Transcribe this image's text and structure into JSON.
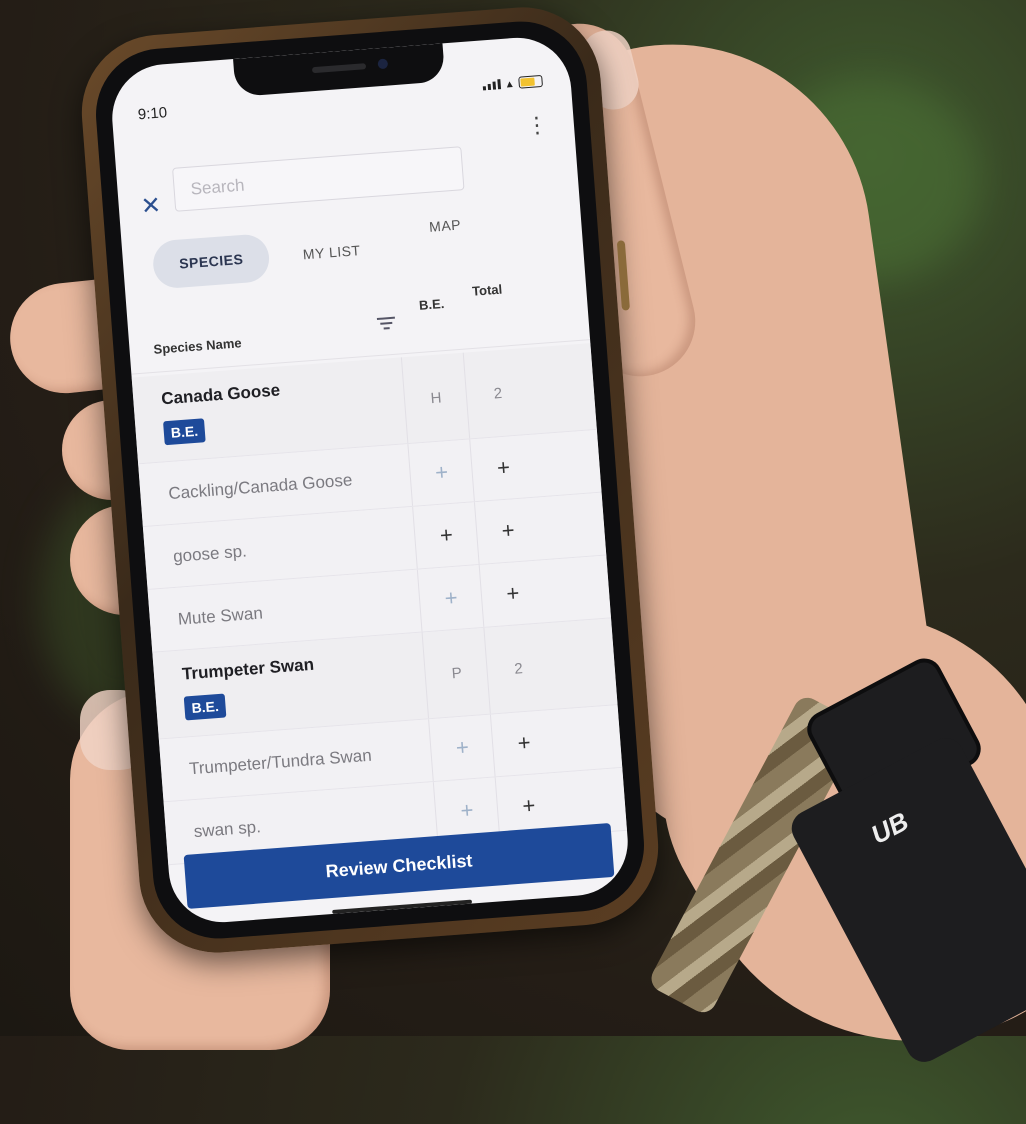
{
  "status_bar": {
    "time": "9:10"
  },
  "search": {
    "placeholder": "Search"
  },
  "tabs": [
    {
      "label": "SPECIES",
      "active": true
    },
    {
      "label": "MY LIST",
      "active": false
    },
    {
      "label": "MAP",
      "active": false
    }
  ],
  "columns": {
    "species": "Species Name",
    "be": "B.E.",
    "total": "Total"
  },
  "species": [
    {
      "name": "Canada Goose",
      "bold": true,
      "badge": "B.E.",
      "be": "H",
      "total": "2"
    },
    {
      "name": "Cackling/Canada Goose",
      "bold": false,
      "be": "+",
      "total": "+"
    },
    {
      "name": "goose sp.",
      "bold": false,
      "be": "+",
      "total": "+"
    },
    {
      "name": "Mute Swan",
      "bold": false,
      "be": "+",
      "total": "+"
    },
    {
      "name": "Trumpeter Swan",
      "bold": true,
      "badge": "B.E.",
      "be": "P",
      "total": "2"
    },
    {
      "name": "Trumpeter/Tundra Swan",
      "bold": false,
      "be": "+",
      "total": "+"
    },
    {
      "name": "swan sp.",
      "bold": false,
      "be": "+",
      "total": "+"
    }
  ],
  "review_button": "Review Checklist",
  "watch": {
    "brand": "UB"
  },
  "colors": {
    "accent": "#1e4a9a",
    "tab_active_bg": "#dcdfe8"
  }
}
